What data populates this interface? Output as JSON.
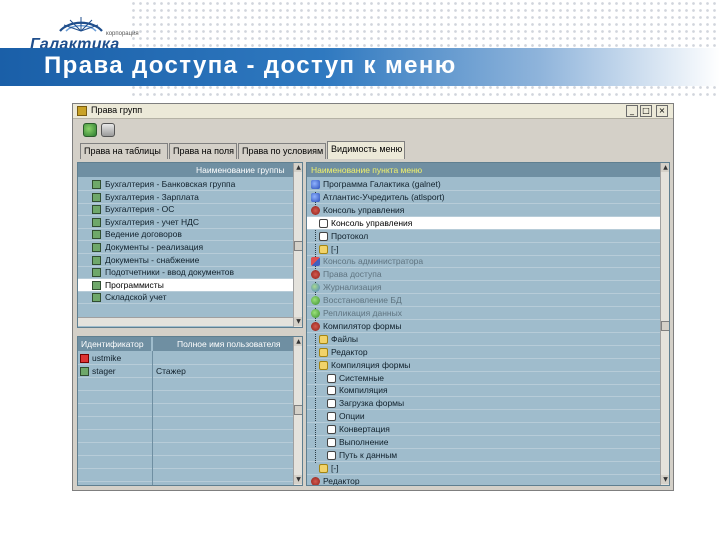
{
  "slide": {
    "logo_small": "корпорация",
    "logo_name": "Галактика",
    "title": "Права доступа - доступ к меню"
  },
  "window": {
    "title": "Права групп",
    "controls": {
      "minimize": "_",
      "maximize": "□",
      "close": "×"
    },
    "tabs": [
      {
        "label": "Права на таблицы",
        "active": false
      },
      {
        "label": "Права на поля",
        "active": false
      },
      {
        "label": "Права по условиям",
        "active": false
      },
      {
        "label": "Видимость меню",
        "active": true
      }
    ]
  },
  "groups_panel": {
    "header": "Наименование группы",
    "rows": [
      {
        "label": "Бухгалтерия - Банковская группа",
        "selected": false
      },
      {
        "label": "Бухгалтерия - Зарплата",
        "selected": false
      },
      {
        "label": "Бухгалтерия - ОС",
        "selected": false
      },
      {
        "label": "Бухгалтерия - учет НДС",
        "selected": false
      },
      {
        "label": "Ведение договоров",
        "selected": false
      },
      {
        "label": "Документы - реализация",
        "selected": false
      },
      {
        "label": "Документы - снабжение",
        "selected": false
      },
      {
        "label": "Подотчетники - ввод документов",
        "selected": false
      },
      {
        "label": "Программисты",
        "selected": true
      },
      {
        "label": "Складской учет",
        "selected": false
      }
    ]
  },
  "users_panel": {
    "headers": [
      "Идентификатор",
      "Полное имя пользователя"
    ],
    "rows": [
      {
        "id": "ustmike",
        "name": ""
      },
      {
        "id": "stager",
        "name": "Стажер"
      }
    ]
  },
  "menu_panel": {
    "header": "Наименование пункта меню",
    "items": [
      {
        "label": "Программа Галактика (galnet)",
        "level": 0,
        "icon": "blue-node-icon",
        "gray": false,
        "selected": false
      },
      {
        "label": "Атлантис-Учредитель (atlsport)",
        "level": 0,
        "icon": "blue-node-icon",
        "gray": false,
        "selected": false
      },
      {
        "label": "Консоль управления",
        "level": 0,
        "icon": "gear-icon",
        "gray": false,
        "selected": false
      },
      {
        "label": "Консоль управления",
        "level": 1,
        "icon": "document-icon",
        "gray": false,
        "selected": true
      },
      {
        "label": "Протокол",
        "level": 1,
        "icon": "document-icon",
        "gray": false,
        "selected": false
      },
      {
        "label": "[-]",
        "level": 1,
        "icon": "folder-icon",
        "gray": false,
        "selected": false
      },
      {
        "label": "Консоль администратора",
        "level": 0,
        "icon": "flag-icon",
        "gray": true,
        "selected": false
      },
      {
        "label": "Права доступа",
        "level": 0,
        "icon": "gear-icon",
        "gray": true,
        "selected": false
      },
      {
        "label": "Журнализация",
        "level": 0,
        "icon": "globe-icon",
        "gray": true,
        "selected": false
      },
      {
        "label": "Восстановление БД",
        "level": 0,
        "icon": "green-node-icon",
        "gray": true,
        "selected": false
      },
      {
        "label": "Репликация данных",
        "level": 0,
        "icon": "green-node-icon",
        "gray": true,
        "selected": false
      },
      {
        "label": "Компилятор формы",
        "level": 0,
        "icon": "gear-icon",
        "gray": false,
        "selected": false
      },
      {
        "label": "Файлы",
        "level": 1,
        "icon": "folder-icon",
        "gray": false,
        "selected": false
      },
      {
        "label": "Редактор",
        "level": 1,
        "icon": "folder-icon",
        "gray": false,
        "selected": false
      },
      {
        "label": "Компиляция формы",
        "level": 1,
        "icon": "folder-icon",
        "gray": false,
        "selected": false
      },
      {
        "label": "Системные",
        "level": 2,
        "icon": "document-icon",
        "gray": false,
        "selected": false
      },
      {
        "label": "Компиляция",
        "level": 2,
        "icon": "document-icon",
        "gray": false,
        "selected": false
      },
      {
        "label": "Загрузка формы",
        "level": 2,
        "icon": "document-icon",
        "gray": false,
        "selected": false
      },
      {
        "label": "Опции",
        "level": 2,
        "icon": "document-icon",
        "gray": false,
        "selected": false
      },
      {
        "label": "Конвертация",
        "level": 2,
        "icon": "document-icon",
        "gray": false,
        "selected": false
      },
      {
        "label": "Выполнение",
        "level": 2,
        "icon": "document-icon",
        "gray": false,
        "selected": false
      },
      {
        "label": "Путь к данным",
        "level": 2,
        "icon": "document-icon",
        "gray": false,
        "selected": false
      },
      {
        "label": "[-]",
        "level": 1,
        "icon": "folder-icon",
        "gray": false,
        "selected": false
      },
      {
        "label": "Редактор",
        "level": 0,
        "icon": "gear-icon",
        "gray": false,
        "selected": false
      }
    ]
  },
  "colors": {
    "panel_bg": "#9fbccc",
    "header_bg": "#6f8fa2",
    "menu_header_text": "#f2f26a",
    "title_bar": "#1a5fa8"
  }
}
